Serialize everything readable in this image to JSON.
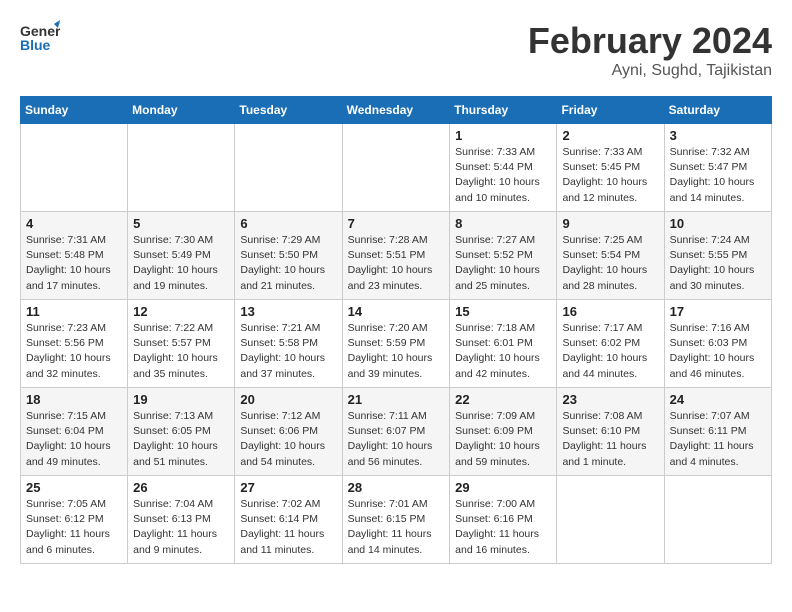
{
  "header": {
    "logo_line1": "General",
    "logo_line2": "Blue",
    "month": "February 2024",
    "location": "Ayni, Sughd, Tajikistan"
  },
  "weekdays": [
    "Sunday",
    "Monday",
    "Tuesday",
    "Wednesday",
    "Thursday",
    "Friday",
    "Saturday"
  ],
  "weeks": [
    [
      {
        "day": "",
        "info": ""
      },
      {
        "day": "",
        "info": ""
      },
      {
        "day": "",
        "info": ""
      },
      {
        "day": "",
        "info": ""
      },
      {
        "day": "1",
        "info": "Sunrise: 7:33 AM\nSunset: 5:44 PM\nDaylight: 10 hours\nand 10 minutes."
      },
      {
        "day": "2",
        "info": "Sunrise: 7:33 AM\nSunset: 5:45 PM\nDaylight: 10 hours\nand 12 minutes."
      },
      {
        "day": "3",
        "info": "Sunrise: 7:32 AM\nSunset: 5:47 PM\nDaylight: 10 hours\nand 14 minutes."
      }
    ],
    [
      {
        "day": "4",
        "info": "Sunrise: 7:31 AM\nSunset: 5:48 PM\nDaylight: 10 hours\nand 17 minutes."
      },
      {
        "day": "5",
        "info": "Sunrise: 7:30 AM\nSunset: 5:49 PM\nDaylight: 10 hours\nand 19 minutes."
      },
      {
        "day": "6",
        "info": "Sunrise: 7:29 AM\nSunset: 5:50 PM\nDaylight: 10 hours\nand 21 minutes."
      },
      {
        "day": "7",
        "info": "Sunrise: 7:28 AM\nSunset: 5:51 PM\nDaylight: 10 hours\nand 23 minutes."
      },
      {
        "day": "8",
        "info": "Sunrise: 7:27 AM\nSunset: 5:52 PM\nDaylight: 10 hours\nand 25 minutes."
      },
      {
        "day": "9",
        "info": "Sunrise: 7:25 AM\nSunset: 5:54 PM\nDaylight: 10 hours\nand 28 minutes."
      },
      {
        "day": "10",
        "info": "Sunrise: 7:24 AM\nSunset: 5:55 PM\nDaylight: 10 hours\nand 30 minutes."
      }
    ],
    [
      {
        "day": "11",
        "info": "Sunrise: 7:23 AM\nSunset: 5:56 PM\nDaylight: 10 hours\nand 32 minutes."
      },
      {
        "day": "12",
        "info": "Sunrise: 7:22 AM\nSunset: 5:57 PM\nDaylight: 10 hours\nand 35 minutes."
      },
      {
        "day": "13",
        "info": "Sunrise: 7:21 AM\nSunset: 5:58 PM\nDaylight: 10 hours\nand 37 minutes."
      },
      {
        "day": "14",
        "info": "Sunrise: 7:20 AM\nSunset: 5:59 PM\nDaylight: 10 hours\nand 39 minutes."
      },
      {
        "day": "15",
        "info": "Sunrise: 7:18 AM\nSunset: 6:01 PM\nDaylight: 10 hours\nand 42 minutes."
      },
      {
        "day": "16",
        "info": "Sunrise: 7:17 AM\nSunset: 6:02 PM\nDaylight: 10 hours\nand 44 minutes."
      },
      {
        "day": "17",
        "info": "Sunrise: 7:16 AM\nSunset: 6:03 PM\nDaylight: 10 hours\nand 46 minutes."
      }
    ],
    [
      {
        "day": "18",
        "info": "Sunrise: 7:15 AM\nSunset: 6:04 PM\nDaylight: 10 hours\nand 49 minutes."
      },
      {
        "day": "19",
        "info": "Sunrise: 7:13 AM\nSunset: 6:05 PM\nDaylight: 10 hours\nand 51 minutes."
      },
      {
        "day": "20",
        "info": "Sunrise: 7:12 AM\nSunset: 6:06 PM\nDaylight: 10 hours\nand 54 minutes."
      },
      {
        "day": "21",
        "info": "Sunrise: 7:11 AM\nSunset: 6:07 PM\nDaylight: 10 hours\nand 56 minutes."
      },
      {
        "day": "22",
        "info": "Sunrise: 7:09 AM\nSunset: 6:09 PM\nDaylight: 10 hours\nand 59 minutes."
      },
      {
        "day": "23",
        "info": "Sunrise: 7:08 AM\nSunset: 6:10 PM\nDaylight: 11 hours\nand 1 minute."
      },
      {
        "day": "24",
        "info": "Sunrise: 7:07 AM\nSunset: 6:11 PM\nDaylight: 11 hours\nand 4 minutes."
      }
    ],
    [
      {
        "day": "25",
        "info": "Sunrise: 7:05 AM\nSunset: 6:12 PM\nDaylight: 11 hours\nand 6 minutes."
      },
      {
        "day": "26",
        "info": "Sunrise: 7:04 AM\nSunset: 6:13 PM\nDaylight: 11 hours\nand 9 minutes."
      },
      {
        "day": "27",
        "info": "Sunrise: 7:02 AM\nSunset: 6:14 PM\nDaylight: 11 hours\nand 11 minutes."
      },
      {
        "day": "28",
        "info": "Sunrise: 7:01 AM\nSunset: 6:15 PM\nDaylight: 11 hours\nand 14 minutes."
      },
      {
        "day": "29",
        "info": "Sunrise: 7:00 AM\nSunset: 6:16 PM\nDaylight: 11 hours\nand 16 minutes."
      },
      {
        "day": "",
        "info": ""
      },
      {
        "day": "",
        "info": ""
      }
    ]
  ]
}
